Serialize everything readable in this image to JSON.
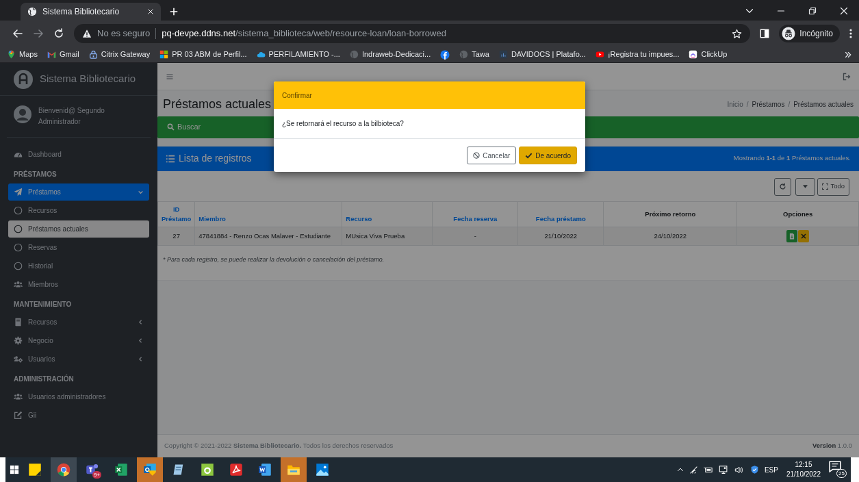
{
  "browser": {
    "tab": {
      "title": "Sistema Bibliotecario"
    },
    "address": {
      "warning": "No es seguro",
      "host": "pq-devpe.ddns.net",
      "path": "/sistema_biblioteca/web/resource-loan/loan-borrowed"
    },
    "profile": "Incógnito",
    "bookmarks": [
      {
        "kind": "link",
        "label": "Maps"
      },
      {
        "kind": "link",
        "label": "Gmail"
      },
      {
        "kind": "link",
        "label": "Citrix Gateway"
      },
      {
        "kind": "link",
        "label": "PR 03 ABM de Perfil..."
      },
      {
        "kind": "link",
        "label": "PERFILAMIENTO -..."
      },
      {
        "kind": "link",
        "label": "Indraweb-Dedicaci..."
      },
      {
        "kind": "icon-only"
      },
      {
        "kind": "link",
        "label": "Tawa"
      },
      {
        "kind": "link",
        "label": "DAVIDOCS | Platafo..."
      },
      {
        "kind": "link",
        "label": "¡Registra tu impues..."
      },
      {
        "kind": "link",
        "label": "ClickUp"
      }
    ]
  },
  "sidebar": {
    "brand": "Sistema Bibliotecario",
    "greeting": "Bienvenid@ Segundo Administrador",
    "items": [
      {
        "kind": "link",
        "label": "Dashboard",
        "selected": false
      },
      {
        "kind": "header",
        "label": "PRÉSTAMOS"
      },
      {
        "kind": "link",
        "label": "Préstamos",
        "selected": true,
        "expanded": true
      },
      {
        "kind": "sublink",
        "label": "Recursos",
        "selected": false
      },
      {
        "kind": "sublink",
        "label": "Préstamos actuales",
        "selected": true
      },
      {
        "kind": "sublink",
        "label": "Reservas",
        "selected": false
      },
      {
        "kind": "sublink",
        "label": "Historial",
        "selected": false
      },
      {
        "kind": "link",
        "label": "Miembros",
        "selected": false
      },
      {
        "kind": "header",
        "label": "MANTENIMIENTO"
      },
      {
        "kind": "link",
        "label": "Recursos",
        "selected": false,
        "expanded": false
      },
      {
        "kind": "link",
        "label": "Negocio",
        "selected": false,
        "expanded": false
      },
      {
        "kind": "link",
        "label": "Usuarios",
        "selected": false,
        "expanded": false
      },
      {
        "kind": "header",
        "label": "ADMINISTRACIÓN"
      },
      {
        "kind": "link",
        "label": "Usuarios administradores",
        "selected": false
      },
      {
        "kind": "link",
        "label": "Gii",
        "selected": false
      }
    ]
  },
  "content": {
    "title": "Préstamos actuales",
    "breadcrumb": [
      {
        "kind": "link",
        "label": "Inicio"
      },
      {
        "kind": "separator",
        "label": "/"
      },
      {
        "kind": "text",
        "label": "Préstamos"
      },
      {
        "kind": "separator",
        "label": "/"
      },
      {
        "kind": "text",
        "label": "Préstamos actuales"
      }
    ],
    "search_panel": {
      "title": "Buscar"
    },
    "list_panel": {
      "title": "Lista de registros",
      "summary": "Mostrando **1-1** de **1** Préstamos actuales."
    },
    "toolbar": {
      "all_button": "Todo"
    },
    "table": {
      "columns": [
        {
          "label": "ID Préstamo",
          "sortable": true
        },
        {
          "label": "Miembro",
          "sortable": true
        },
        {
          "label": "Recurso",
          "sortable": true
        },
        {
          "label": "Fecha reserva",
          "sortable": true
        },
        {
          "label": "Fecha préstamo",
          "sortable": true
        },
        {
          "label": "Próximo retorno",
          "sortable": false
        },
        {
          "label": "Opciones",
          "sortable": false
        }
      ],
      "rows": [
        {
          "cells": [
            "27",
            "47841884 - Renzo Ocas Malaver - Estudiante",
            "MUsica Viva Prueba",
            "-",
            "21/10/2022",
            "24/10/2022"
          ]
        }
      ]
    },
    "note": "* Para cada registro, se puede realizar la devolución o cancelación del préstamo."
  },
  "footer": {
    "copyright": "Copyright © 2021-2022",
    "link": "Sistema Bibliotecario.",
    "rights": "Todos los derechos reservados",
    "version_label": "Version",
    "version": "1.0.0"
  },
  "modal": {
    "title": "Confirmar",
    "message": "¿Se retornará el recurso a la bilbioteca?",
    "buttons": [
      {
        "label": "Cancelar",
        "kind": "cancel"
      },
      {
        "label": "De acuerdo",
        "kind": "confirm"
      }
    ]
  },
  "taskbar": {
    "apps": [
      {
        "active": false,
        "attention": false
      },
      {
        "active": true,
        "attention": false
      },
      {
        "active": false,
        "attention": false,
        "badge": "9+"
      },
      {
        "active": false,
        "attention": false
      },
      {
        "active": false,
        "attention": true
      },
      {
        "active": false,
        "attention": false
      },
      {
        "active": false,
        "attention": false
      },
      {
        "active": false,
        "attention": false
      },
      {
        "active": false,
        "attention": false
      },
      {
        "active": false,
        "attention": true
      },
      {
        "active": false,
        "attention": false
      }
    ],
    "language": "ESP",
    "time": "12:15",
    "date": "21/10/2022",
    "notifications": "25"
  }
}
